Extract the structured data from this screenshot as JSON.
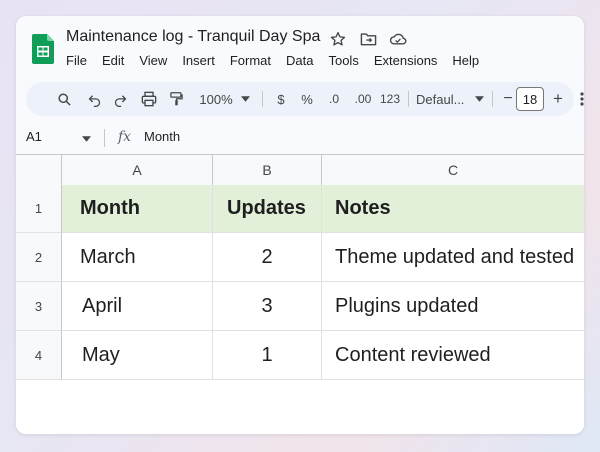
{
  "doc_title": "Maintenance log - Tranquil Day Spa",
  "menu": [
    "File",
    "Edit",
    "View",
    "Insert",
    "Format",
    "Data",
    "Tools",
    "Extensions",
    "Help"
  ],
  "toolbar": {
    "zoom": "100%",
    "currency": "$",
    "percent": "%",
    "decrease_decimal": ".0",
    "increase_decimal": ".00",
    "number_format": "123",
    "font": "Defaul...",
    "font_size": "18",
    "minus": "−",
    "plus": "+"
  },
  "formula_bar": {
    "name_box": "A1",
    "fx": "fx",
    "value": "Month"
  },
  "columns": [
    "A",
    "B",
    "C"
  ],
  "rows": [
    {
      "num": "1",
      "cells": [
        "Month",
        "Updates",
        "Notes"
      ]
    },
    {
      "num": "2",
      "cells": [
        "March",
        "2",
        "Theme updated and tested"
      ]
    },
    {
      "num": "3",
      "cells": [
        "April",
        "3",
        "Plugins updated"
      ]
    },
    {
      "num": "4",
      "cells": [
        "May",
        "1",
        "Content reviewed"
      ]
    }
  ],
  "colors": {
    "header_fill": "#e2f0d9",
    "sheets_green": "#0f9d58"
  }
}
